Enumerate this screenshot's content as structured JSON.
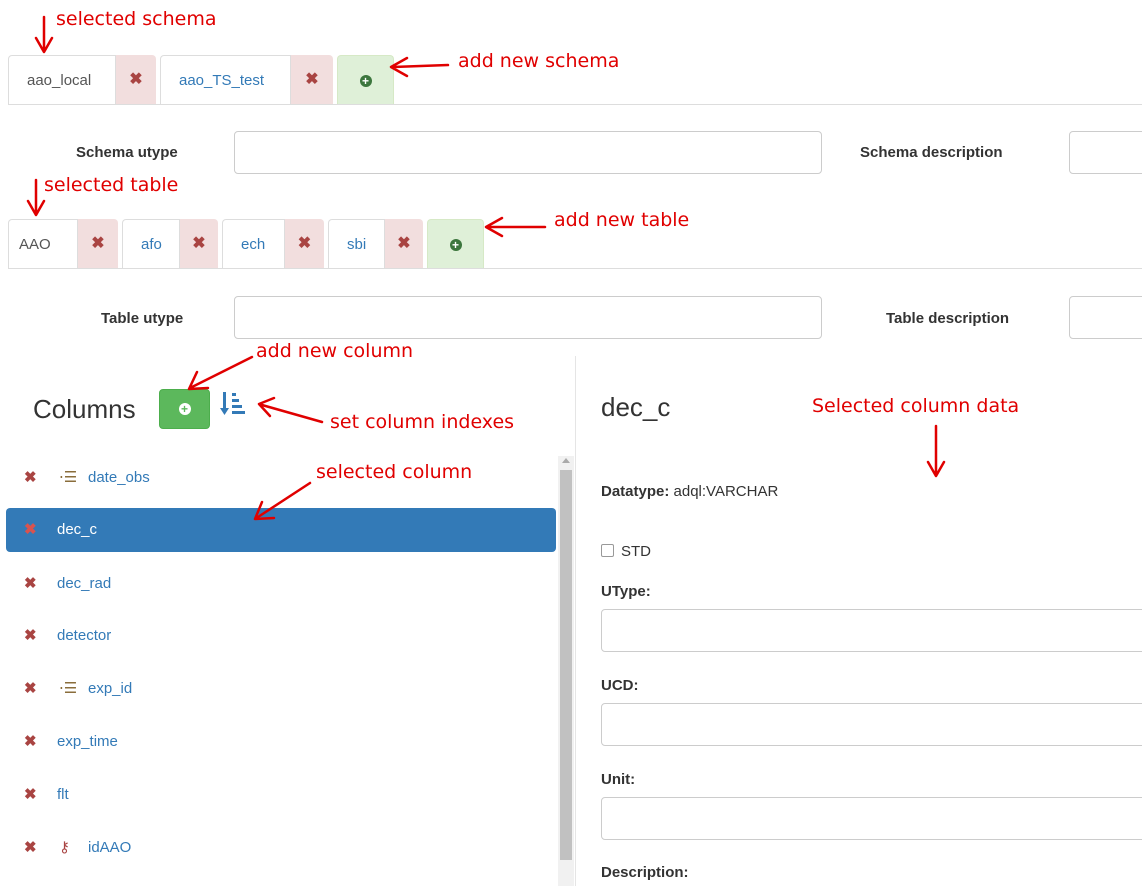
{
  "schema_tabs": [
    {
      "name": "aao_local",
      "active": true
    },
    {
      "name": "aao_TS_test",
      "active": false
    }
  ],
  "table_tabs": [
    {
      "name": "AAO",
      "active": true
    },
    {
      "name": "afo",
      "active": false
    },
    {
      "name": "ech",
      "active": false
    },
    {
      "name": "sbi",
      "active": false
    }
  ],
  "remove_symbol": "✖",
  "add_symbol": "+",
  "schema_fields": {
    "utype_label": "Schema utype",
    "description_label": "Schema description",
    "utype_value": "",
    "description_value": ""
  },
  "table_fields": {
    "utype_label": "Table utype",
    "description_label": "Table description",
    "utype_value": "",
    "description_value": ""
  },
  "columns_panel": {
    "title": "Columns",
    "items": [
      {
        "name": "date_obs",
        "icon": "indexed-list-icon",
        "selected": false
      },
      {
        "name": "dec_c",
        "icon": "",
        "selected": true
      },
      {
        "name": "dec_rad",
        "icon": "",
        "selected": false
      },
      {
        "name": "detector",
        "icon": "",
        "selected": false
      },
      {
        "name": "exp_id",
        "icon": "indexed-list-icon",
        "selected": false
      },
      {
        "name": "exp_time",
        "icon": "",
        "selected": false
      },
      {
        "name": "flt",
        "icon": "",
        "selected": false
      },
      {
        "name": "idAAO",
        "icon": "key-icon",
        "selected": false
      }
    ]
  },
  "column_detail": {
    "title": "dec_c",
    "datatype_label": "Datatype:",
    "datatype_value": "adql:VARCHAR",
    "std_label": "STD",
    "std_checked": false,
    "utype_label": "UType:",
    "ucd_label": "UCD:",
    "unit_label": "Unit:",
    "description_label": "Description:"
  },
  "annotations": {
    "selected_schema": "selected schema",
    "add_new_schema": "add new schema",
    "selected_table": "selected table",
    "add_new_table": "add new table",
    "add_new_column": "add new column",
    "set_column_indexes": "set column indexes",
    "selected_column": "selected column",
    "selected_column_data": "Selected column data"
  },
  "colors": {
    "annotation": "#e00000",
    "link": "#337ab7",
    "selected_bg": "#337ab7",
    "remove_bg": "#f2dede",
    "add_bg": "#dff0d8",
    "add_button": "#5cb85c"
  }
}
